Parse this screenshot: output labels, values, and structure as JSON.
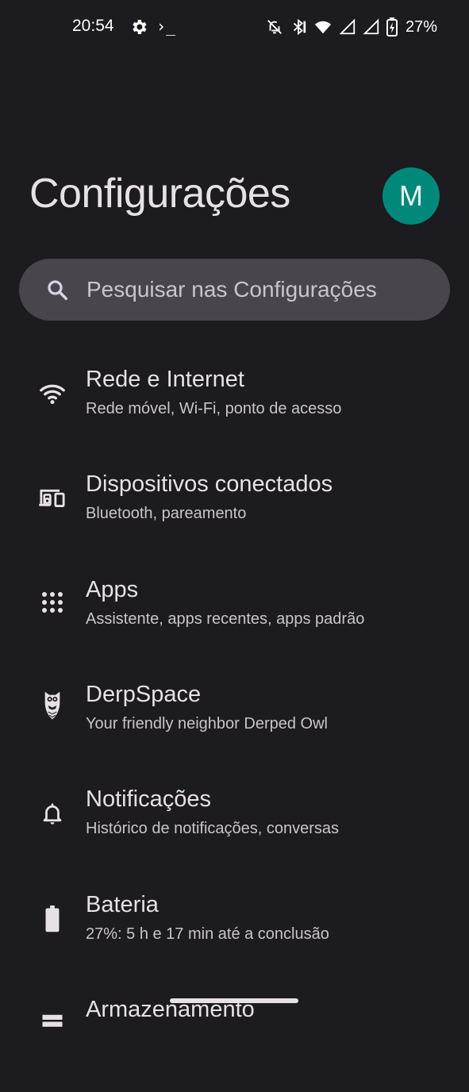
{
  "status_bar": {
    "time": "20:54",
    "left_icons": [
      "gear-icon",
      "terminal-icon"
    ],
    "terminal_glyph": "›_",
    "right_icons": [
      "notifications-off-icon",
      "bluetooth-icon",
      "wifi-icon",
      "signal-icon",
      "signal-icon",
      "battery-charging-icon"
    ],
    "battery_percent": "27%"
  },
  "header": {
    "title": "Configurações",
    "avatar_letter": "M",
    "avatar_color": "#00897b"
  },
  "search": {
    "placeholder": "Pesquisar nas Configurações"
  },
  "settings_items": [
    {
      "icon": "wifi-icon",
      "title": "Rede e Internet",
      "subtitle": "Rede móvel, Wi-Fi, ponto de acesso"
    },
    {
      "icon": "devices-icon",
      "title": "Dispositivos conectados",
      "subtitle": "Bluetooth, pareamento"
    },
    {
      "icon": "apps-grid-icon",
      "title": "Apps",
      "subtitle": "Assistente, apps recentes, apps padrão"
    },
    {
      "icon": "owl-icon",
      "title": "DerpSpace",
      "subtitle": "Your friendly neighbor Derped Owl"
    },
    {
      "icon": "bell-icon",
      "title": "Notificações",
      "subtitle": "Histórico de notificações, conversas"
    },
    {
      "icon": "battery-icon",
      "title": "Bateria",
      "subtitle": "27%: 5 h e 17 min até a conclusão"
    },
    {
      "icon": "storage-icon",
      "title": "Armazenamento",
      "subtitle": ""
    }
  ],
  "colors": {
    "background": "#1c1b1f",
    "search_background": "#48464c",
    "text_primary": "#e6e1e5",
    "text_secondary": "#c9c5ca"
  }
}
